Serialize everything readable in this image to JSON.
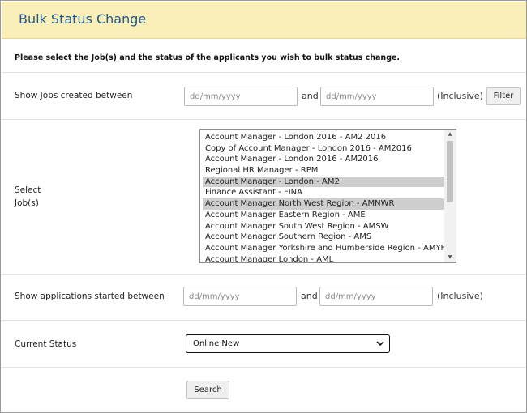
{
  "header": {
    "title": "Bulk Status Change"
  },
  "instructions": "Please select the Job(s) and the status of the applicants you wish to bulk status change.",
  "jobs_created": {
    "label": "Show Jobs created between",
    "from_placeholder": "dd/mm/yyyy",
    "and_text": "and",
    "to_placeholder": "dd/mm/yyyy",
    "inclusive_text": "(Inclusive)",
    "filter_label": "Filter"
  },
  "select_jobs": {
    "label_line1": "Select",
    "label_line2": "Job(s)",
    "options": [
      {
        "text": "Account Manager - London 2016 - AM2 2016",
        "selected": false
      },
      {
        "text": "Copy of Account Manager - London 2016 - AM2016",
        "selected": false
      },
      {
        "text": "Account Manager - London 2016 - AM2016",
        "selected": false
      },
      {
        "text": "Regional HR Manager - RPM",
        "selected": false
      },
      {
        "text": "Account Manager - London - AM2",
        "selected": true
      },
      {
        "text": "Finance Assistant - FINA",
        "selected": false
      },
      {
        "text": "Account Manager North West Region - AMNWR",
        "selected": true
      },
      {
        "text": "Account Manager Eastern Region - AME",
        "selected": false
      },
      {
        "text": "Account Manager South West Region - AMSW",
        "selected": false
      },
      {
        "text": "Account Manager Southern Region - AMS",
        "selected": false
      },
      {
        "text": "Account Manager Yorkshire and Humberside Region - AMYH",
        "selected": false
      },
      {
        "text": "Account Manager London - AML",
        "selected": false
      }
    ]
  },
  "applications_started": {
    "label": "Show applications started between",
    "from_placeholder": "dd/mm/yyyy",
    "and_text": "and",
    "to_placeholder": "dd/mm/yyyy",
    "inclusive_text": "(Inclusive)"
  },
  "current_status": {
    "label": "Current Status",
    "selected_value": "Online New"
  },
  "search_label": "Search"
}
